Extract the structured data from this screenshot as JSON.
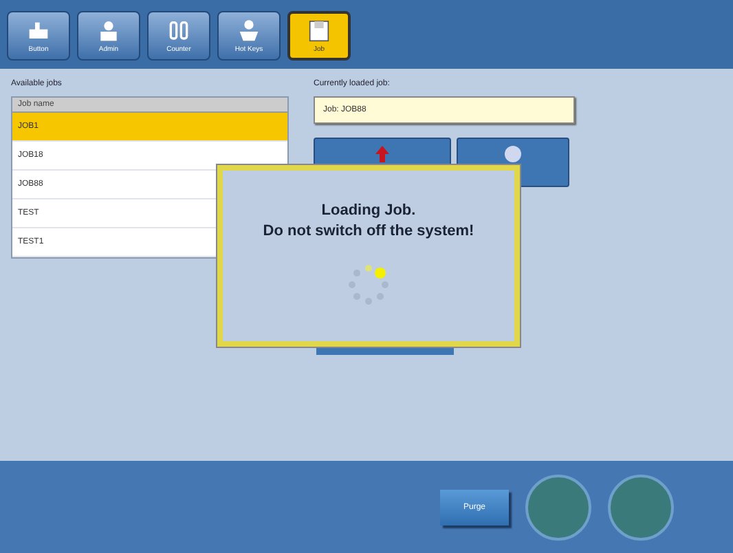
{
  "tabs": [
    {
      "label": "Button",
      "selected": false
    },
    {
      "label": "Admin",
      "selected": false
    },
    {
      "label": "Counter",
      "selected": false
    },
    {
      "label": "Hot Keys",
      "selected": false
    },
    {
      "label": "Job",
      "selected": true
    }
  ],
  "available_jobs": {
    "label": "Available jobs",
    "column": "Job name",
    "rows": [
      {
        "name": "JOB1",
        "selected": true
      },
      {
        "name": "JOB18",
        "selected": false
      },
      {
        "name": "JOB88",
        "selected": false
      },
      {
        "name": "TEST",
        "selected": false
      },
      {
        "name": "TEST1",
        "selected": false
      }
    ]
  },
  "current_job": {
    "label": "Currently loaded job:",
    "value": "Job: JOB88"
  },
  "dialog": {
    "lines": [
      "Loading Job.",
      "Do not switch off the system!"
    ]
  },
  "footer": {
    "button": "Purge"
  }
}
